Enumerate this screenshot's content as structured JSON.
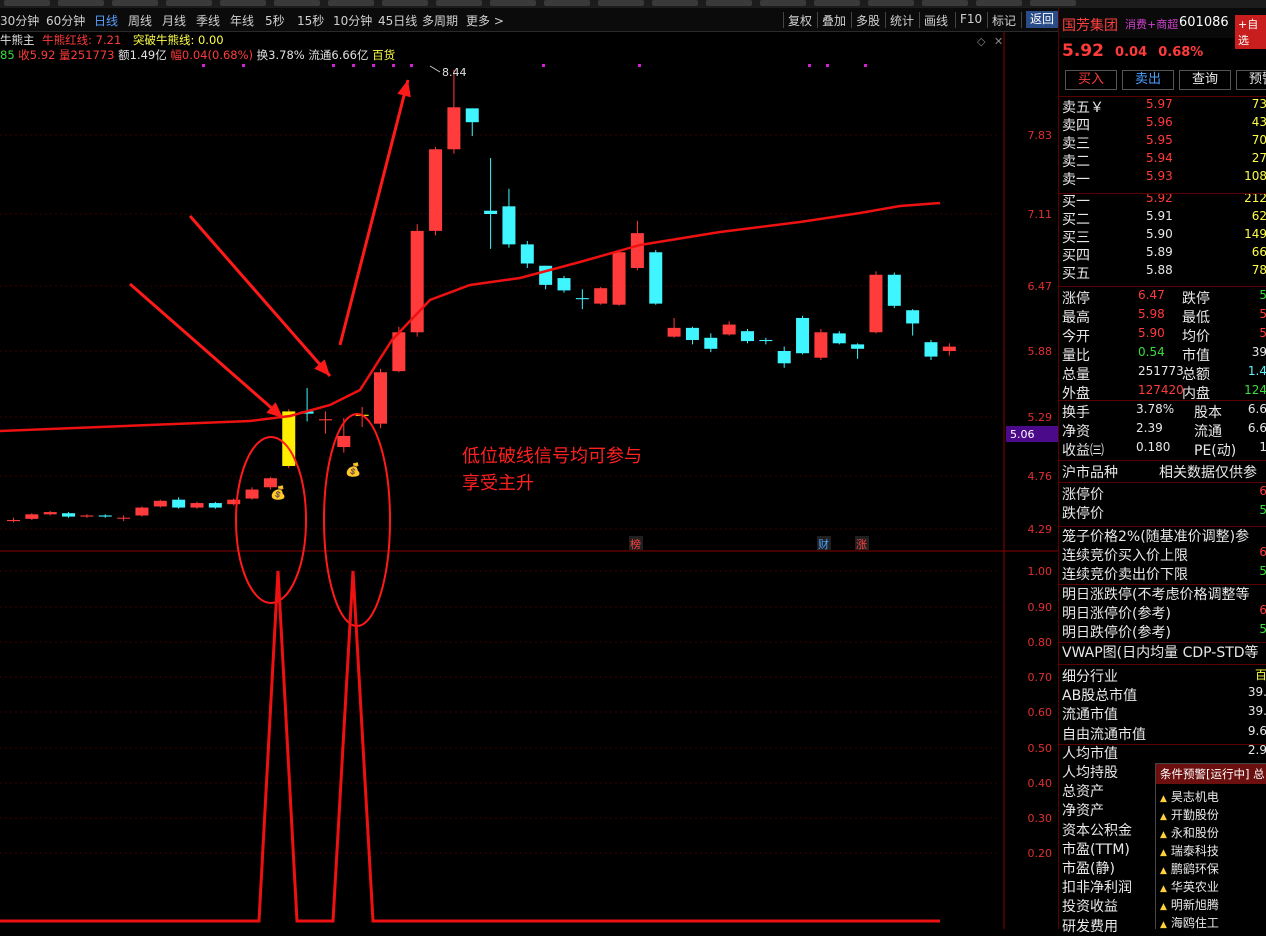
{
  "top_tabs": [
    "",
    "",
    "",
    "",
    "",
    "",
    "",
    "",
    "",
    "",
    "",
    "",
    "",
    "",
    "",
    "",
    "",
    "",
    "",
    ""
  ],
  "periods": [
    "30分钟",
    "60分钟",
    "日线",
    "周线",
    "月线",
    "季线",
    "年线",
    "5秒",
    "15秒",
    "10分钟",
    "45日线",
    "多周期",
    "更多 >"
  ],
  "active_period": "日线",
  "toolbar": [
    "复权",
    "叠加",
    "多股",
    "统计",
    "画线",
    "F10",
    "标记",
    "返回"
  ],
  "indicator_line": {
    "name": "牛熊主",
    "items": [
      {
        "label": "牛熊红线: 7.21",
        "color": "#ff3b3b"
      },
      {
        "label": "突破牛熊线: 0.00",
        "color": "#ffff4a"
      }
    ]
  },
  "quote_line": {
    "items": [
      {
        "text": "85",
        "color": "#3cdc3c"
      },
      {
        "text": " 收5.92",
        "color": "#ff3b3b"
      },
      {
        "text": " 量251773",
        "color": "#ff3b3b"
      },
      {
        "text": " 额1.49亿",
        "color": "#e0e0e0"
      },
      {
        "text": " 幅0.04(0.68%)",
        "color": "#ff3b3b"
      },
      {
        "text": " 换3.78%",
        "color": "#e0e0e0"
      },
      {
        "text": " 流通6.66亿",
        "color": "#e0e0e0"
      },
      {
        "text": " 百货",
        "color": "#ffff4a"
      }
    ]
  },
  "chart_data": {
    "type": "candlestick",
    "peak_label": "8.44",
    "price_axis": [
      "7.83",
      "7.11",
      "6.47",
      "5.88",
      "5.29",
      "4.76",
      "4.29"
    ],
    "current_price_tag": "5.06",
    "indicator_axis": [
      "1.00",
      "0.90",
      "0.80",
      "0.70",
      "0.60",
      "0.50",
      "0.40",
      "0.30",
      "0.20"
    ],
    "candles": [
      {
        "o": 4.36,
        "c": 4.37,
        "h": 4.39,
        "l": 4.35
      },
      {
        "o": 4.38,
        "c": 4.42,
        "h": 4.43,
        "l": 4.37
      },
      {
        "o": 4.42,
        "c": 4.44,
        "h": 4.45,
        "l": 4.41
      },
      {
        "o": 4.43,
        "c": 4.4,
        "h": 4.44,
        "l": 4.39
      },
      {
        "o": 4.4,
        "c": 4.41,
        "h": 4.42,
        "l": 4.39
      },
      {
        "o": 4.41,
        "c": 4.4,
        "h": 4.42,
        "l": 4.39
      },
      {
        "o": 4.39,
        "c": 4.39,
        "h": 4.41,
        "l": 4.36
      },
      {
        "o": 4.41,
        "c": 4.48,
        "h": 4.49,
        "l": 4.4
      },
      {
        "o": 4.49,
        "c": 4.54,
        "h": 4.55,
        "l": 4.48
      },
      {
        "o": 4.55,
        "c": 4.48,
        "h": 4.57,
        "l": 4.47
      },
      {
        "o": 4.48,
        "c": 4.52,
        "h": 4.53,
        "l": 4.47
      },
      {
        "o": 4.52,
        "c": 4.48,
        "h": 4.53,
        "l": 4.47
      },
      {
        "o": 4.51,
        "c": 4.55,
        "h": 4.56,
        "l": 4.5
      },
      {
        "o": 4.56,
        "c": 4.64,
        "h": 4.66,
        "l": 4.55
      },
      {
        "o": 4.66,
        "c": 4.74,
        "h": 4.75,
        "l": 4.64
      },
      {
        "o": 4.85,
        "c": 5.34,
        "h": 5.36,
        "l": 4.83
      },
      {
        "o": 5.34,
        "c": 5.32,
        "h": 5.55,
        "l": 5.25
      },
      {
        "o": 5.26,
        "c": 5.27,
        "h": 5.34,
        "l": 5.14
      },
      {
        "o": 5.02,
        "c": 5.12,
        "h": 5.28,
        "l": 4.97
      },
      {
        "o": 5.3,
        "c": 5.31,
        "h": 5.38,
        "l": 5.2
      },
      {
        "o": 5.23,
        "c": 5.69,
        "h": 5.72,
        "l": 5.19
      },
      {
        "o": 5.7,
        "c": 6.05,
        "h": 6.1,
        "l": 5.69
      },
      {
        "o": 6.05,
        "c": 6.96,
        "h": 7.02,
        "l": 6.01
      },
      {
        "o": 6.96,
        "c": 7.7,
        "h": 7.72,
        "l": 6.92
      },
      {
        "o": 7.7,
        "c": 8.09,
        "h": 8.44,
        "l": 7.66
      },
      {
        "o": 8.08,
        "c": 7.95,
        "h": 8.08,
        "l": 7.82
      },
      {
        "o": 7.14,
        "c": 7.11,
        "h": 7.62,
        "l": 6.8
      },
      {
        "o": 7.18,
        "c": 6.84,
        "h": 7.34,
        "l": 6.81
      },
      {
        "o": 6.84,
        "c": 6.67,
        "h": 6.87,
        "l": 6.63
      },
      {
        "o": 6.65,
        "c": 6.48,
        "h": 6.65,
        "l": 6.44
      },
      {
        "o": 6.54,
        "c": 6.43,
        "h": 6.56,
        "l": 6.41
      },
      {
        "o": 6.36,
        "c": 6.35,
        "h": 6.44,
        "l": 6.26
      },
      {
        "o": 6.31,
        "c": 6.45,
        "h": 6.46,
        "l": 6.3
      },
      {
        "o": 6.3,
        "c": 6.77,
        "h": 6.79,
        "l": 6.29
      },
      {
        "o": 6.63,
        "c": 6.94,
        "h": 7.05,
        "l": 6.61
      },
      {
        "o": 6.77,
        "c": 6.31,
        "h": 6.79,
        "l": 6.3
      },
      {
        "o": 6.01,
        "c": 6.09,
        "h": 6.18,
        "l": 6.0
      },
      {
        "o": 6.09,
        "c": 5.98,
        "h": 6.1,
        "l": 5.94
      },
      {
        "o": 6.0,
        "c": 5.9,
        "h": 6.04,
        "l": 5.87
      },
      {
        "o": 6.03,
        "c": 6.12,
        "h": 6.15,
        "l": 6.02
      },
      {
        "o": 6.06,
        "c": 5.97,
        "h": 6.08,
        "l": 5.95
      },
      {
        "o": 5.98,
        "c": 5.97,
        "h": 6.0,
        "l": 5.94
      },
      {
        "o": 5.88,
        "c": 5.77,
        "h": 5.92,
        "l": 5.73
      },
      {
        "o": 6.18,
        "c": 5.86,
        "h": 6.2,
        "l": 5.85
      },
      {
        "o": 5.82,
        "c": 6.05,
        "h": 6.08,
        "l": 5.8
      },
      {
        "o": 6.04,
        "c": 5.95,
        "h": 6.06,
        "l": 5.94
      },
      {
        "o": 5.94,
        "c": 5.9,
        "h": 5.95,
        "l": 5.81
      },
      {
        "o": 6.05,
        "c": 6.57,
        "h": 6.6,
        "l": 6.04
      },
      {
        "o": 6.57,
        "c": 6.29,
        "h": 6.59,
        "l": 6.27
      },
      {
        "o": 6.25,
        "c": 6.13,
        "h": 6.26,
        "l": 6.02
      },
      {
        "o": 5.96,
        "c": 5.83,
        "h": 5.98,
        "l": 5.8
      },
      {
        "o": 5.88,
        "c": 5.92,
        "h": 5.95,
        "l": 5.84
      }
    ],
    "annotation": [
      "低位破线信号均可参与",
      "享受主升"
    ],
    "event_tags": [
      {
        "text": "榜",
        "color": "#ff4040"
      },
      {
        "text": "财",
        "color": "#4aa0ff"
      },
      {
        "text": "涨",
        "color": "#ff4040"
      }
    ]
  },
  "stock": {
    "name": "国芳集团",
    "tags": "消费+商超",
    "code": "601086",
    "add_btn": "+自选",
    "price": "5.92",
    "change": "0.04",
    "pct": "0.68%"
  },
  "trade_buttons": [
    "买入",
    "卖出",
    "查询",
    "预警"
  ],
  "orderbook": {
    "asks": [
      {
        "label": "卖五￥",
        "price": "5.97",
        "vol": "73"
      },
      {
        "label": "卖四",
        "price": "5.96",
        "vol": "43"
      },
      {
        "label": "卖三",
        "price": "5.95",
        "vol": "70"
      },
      {
        "label": "卖二",
        "price": "5.94",
        "vol": "27"
      },
      {
        "label": "卖一",
        "price": "5.93",
        "vol": "108"
      }
    ],
    "bids": [
      {
        "label": "买一",
        "price": "5.92",
        "vol": "212"
      },
      {
        "label": "买二",
        "price": "5.91",
        "vol": "62"
      },
      {
        "label": "买三",
        "price": "5.90",
        "vol": "149"
      },
      {
        "label": "买四",
        "price": "5.89",
        "vol": "66"
      },
      {
        "label": "买五",
        "price": "5.88",
        "vol": "78"
      }
    ]
  },
  "stats": [
    {
      "l1": "涨停",
      "v1": "6.47",
      "c1": "#ff3b3b",
      "l2": "跌停",
      "v2": "5",
      "c2": "#3cdc3c"
    },
    {
      "l1": "最高",
      "v1": "5.98",
      "c1": "#ff3b3b",
      "l2": "最低",
      "v2": "5",
      "c2": "#ff3b3b"
    },
    {
      "l1": "今开",
      "v1": "5.90",
      "c1": "#ff3b3b",
      "l2": "均价",
      "v2": "5",
      "c2": "#ff3b3b"
    },
    {
      "l1": "量比",
      "v1": "0.54",
      "c1": "#3cdc3c",
      "l2": "市值",
      "v2": "39",
      "c2": "#e8e8e8"
    },
    {
      "l1": "总量",
      "v1": "251773",
      "c1": "#e8e8e8",
      "l2": "总额",
      "v2": "1.4",
      "c2": "#5ff5ff"
    },
    {
      "l1": "外盘",
      "v1": "127420",
      "c1": "#ff3b3b",
      "l2": "内盘",
      "v2": "124",
      "c2": "#3cdc3c"
    }
  ],
  "stats2": [
    {
      "l1": "换手",
      "v1": "3.78%",
      "l2": "股本",
      "v2": "6.6"
    },
    {
      "l1": "净资",
      "v1": "2.39",
      "l2": "流通",
      "v2": "6.6"
    },
    {
      "l1": "收益㈢",
      "v1": "0.180",
      "l2": "PE(动)",
      "v2": "1"
    }
  ],
  "market_header": {
    "left": "沪市品种",
    "right": "相关数据仅供参"
  },
  "market_rows": [
    {
      "label": "涨停价",
      "value": "6",
      "color": "#ff3b3b"
    },
    {
      "label": "跌停价",
      "value": "5",
      "color": "#3cdc3c"
    },
    {
      "label": "笼子价格2%(随基准价调整)参",
      "value": "",
      "color": "#e8e8e8"
    },
    {
      "label": "连续竞价买入价上限",
      "value": "6",
      "color": "#ff3b3b"
    },
    {
      "label": "连续竞价卖出价下限",
      "value": "5",
      "color": "#3cdc3c"
    },
    {
      "label": "明日涨跌停(不考虑价格调整等",
      "value": "",
      "color": "#e8e8e8"
    },
    {
      "label": "明日涨停价(参考)",
      "value": "6",
      "color": "#ff3b3b"
    },
    {
      "label": "明日跌停价(参考)",
      "value": "5",
      "color": "#3cdc3c"
    },
    {
      "label": "VWAP图(日内均量 CDP-STD等",
      "value": "",
      "color": "#e8e8e8"
    }
  ],
  "fund_rows": [
    {
      "label": "细分行业",
      "value": "百",
      "color": "#ffff4a"
    },
    {
      "label": "AB股总市值",
      "value": "39.",
      "color": "#e8e8e8"
    },
    {
      "label": "流通市值",
      "value": "39.",
      "color": "#e8e8e8"
    },
    {
      "label": "自由流通市值",
      "value": "9.6",
      "color": "#e8e8e8"
    },
    {
      "label": "人均市值",
      "value": "2.9",
      "color": "#e8e8e8"
    },
    {
      "label": "人均持股",
      "value": "",
      "color": "#e8e8e8"
    },
    {
      "label": "总资产",
      "value": "",
      "color": "#e8e8e8"
    },
    {
      "label": "净资产",
      "value": "",
      "color": "#e8e8e8"
    },
    {
      "label": "资本公积金",
      "value": "",
      "color": "#e8e8e8"
    },
    {
      "label": "市盈(TTM)",
      "value": "",
      "color": "#e8e8e8"
    },
    {
      "label": "市盈(静)",
      "value": "",
      "color": "#e8e8e8"
    },
    {
      "label": "扣非净利润",
      "value": "",
      "color": "#e8e8e8"
    },
    {
      "label": "投资收益",
      "value": "",
      "color": "#e8e8e8"
    },
    {
      "label": "研发费用",
      "value": "",
      "color": "#e8e8e8"
    }
  ],
  "alert": {
    "title": "条件预警[运行中] 总",
    "items": [
      "昊志机电",
      "开勤股份",
      "永和股份",
      "瑞泰科技",
      "鹏鹞环保",
      "华英农业",
      "明新旭腾",
      "海鸥住工"
    ]
  }
}
